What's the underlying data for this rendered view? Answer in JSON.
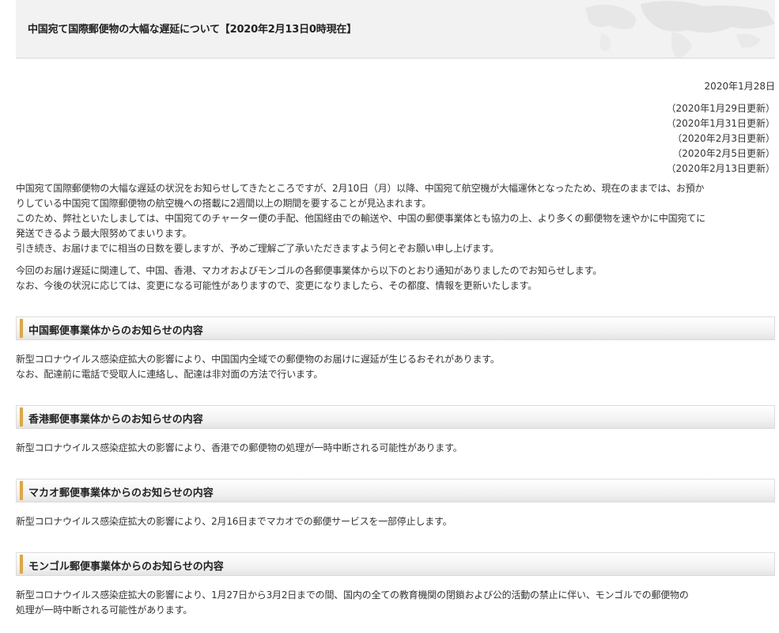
{
  "header": {
    "title": "中国宛て国際郵便物の大幅な遅延について【2020年2月13日0時現在】"
  },
  "dates": {
    "published": "2020年1月28日",
    "updates": [
      "（2020年1月29日更新）",
      "（2020年1月31日更新）",
      "（2020年2月3日更新）",
      "（2020年2月5日更新）",
      "（2020年2月13日更新）"
    ]
  },
  "intro": {
    "para1": [
      "中国宛て国際郵便物の大幅な遅延の状況をお知らせしてきたところですが、2月10日（月）以降、中国宛て航空機が大幅運休となったため、現在のままでは、お預か",
      "りしている中国宛て国際郵便物の航空機への搭載に2週間以上の期間を要することが見込まれます。",
      "このため、弊社といたしましては、中国宛てのチャーター便の手配、他国経由での輸送や、中国の郵便事業体とも協力の上、より多くの郵便物を速やかに中国宛てに",
      "発送できるよう最大限努めてまいります。",
      "引き続き、お届けまでに相当の日数を要しますが、予めご理解ご了承いただきますよう何とぞお願い申し上げます。"
    ],
    "para2": [
      "今回のお届け遅延に関連して、中国、香港、マカオおよびモンゴルの各郵便事業体から以下のとおり通知がありましたのでお知らせします。",
      "なお、今後の状況に応じては、変更になる可能性がありますので、変更になりましたら、その都度、情報を更新いたします。"
    ]
  },
  "sections": [
    {
      "title": "中国郵便事業体からのお知らせの内容",
      "lines": [
        "新型コロナウイルス感染症拡大の影響により、中国国内全域での郵便物のお届けに遅延が生じるおそれがあります。",
        "なお、配達前に電話で受取人に連絡し、配達は非対面の方法で行います。"
      ]
    },
    {
      "title": "香港郵便事業体からのお知らせの内容",
      "lines": [
        "新型コロナウイルス感染症拡大の影響により、香港での郵便物の処理が一時中断される可能性があります。"
      ]
    },
    {
      "title": "マカオ郵便事業体からのお知らせの内容",
      "lines": [
        "新型コロナウイルス感染症拡大の影響により、2月16日までマカオでの郵便サービスを一部停止します。"
      ]
    },
    {
      "title": "モンゴル郵便事業体からのお知らせの内容",
      "lines": [
        "新型コロナウイルス感染症拡大の影響により、1月27日から3月2日までの間、国内の全ての教育機関の閉鎖および公的活動の禁止に伴い、モンゴルでの郵便物の",
        "処理が一時中断される可能性があります。"
      ]
    }
  ]
}
